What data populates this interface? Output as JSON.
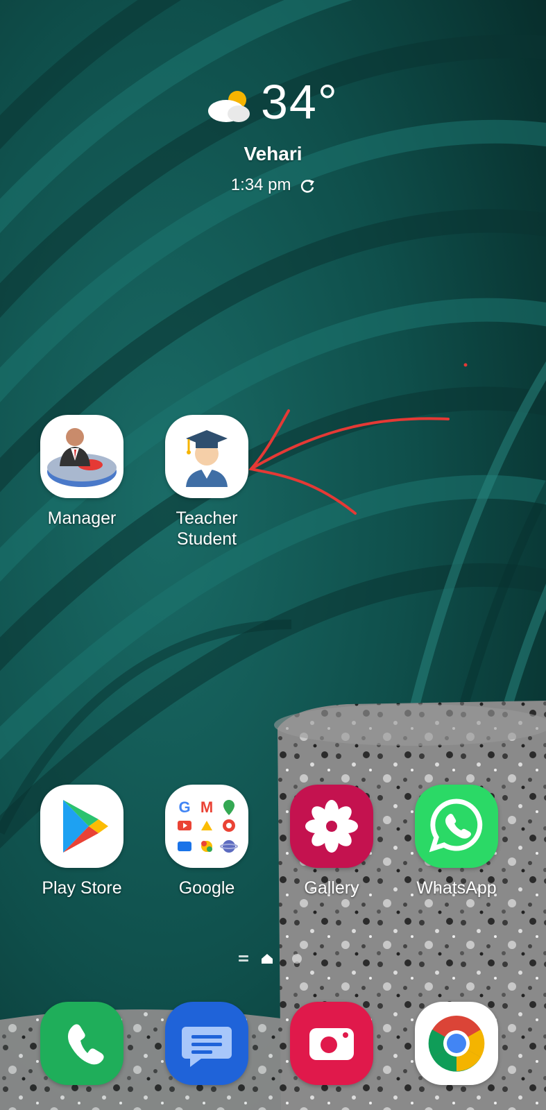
{
  "weather": {
    "temperature": "34°",
    "city": "Vehari",
    "time": "1:34 pm",
    "icon": "partly-cloudy-icon"
  },
  "home_apps": [
    {
      "label": "Manager",
      "icon": "manager-app-icon"
    },
    {
      "label": "Teacher\nStudent",
      "icon": "graduate-icon"
    }
  ],
  "row_apps": [
    {
      "label": "Play Store",
      "icon": "play-store-icon"
    },
    {
      "label": "Google",
      "icon": "google-folder-icon"
    },
    {
      "label": "Gallery",
      "icon": "gallery-icon"
    },
    {
      "label": "WhatsApp",
      "icon": "whatsapp-icon"
    }
  ],
  "dock": [
    {
      "icon": "phone-icon"
    },
    {
      "icon": "messages-icon"
    },
    {
      "icon": "camera-icon"
    },
    {
      "icon": "chrome-icon"
    }
  ],
  "colors": {
    "annotation_red": "#e53935",
    "wallpaper_teal": "#0e4d49"
  }
}
